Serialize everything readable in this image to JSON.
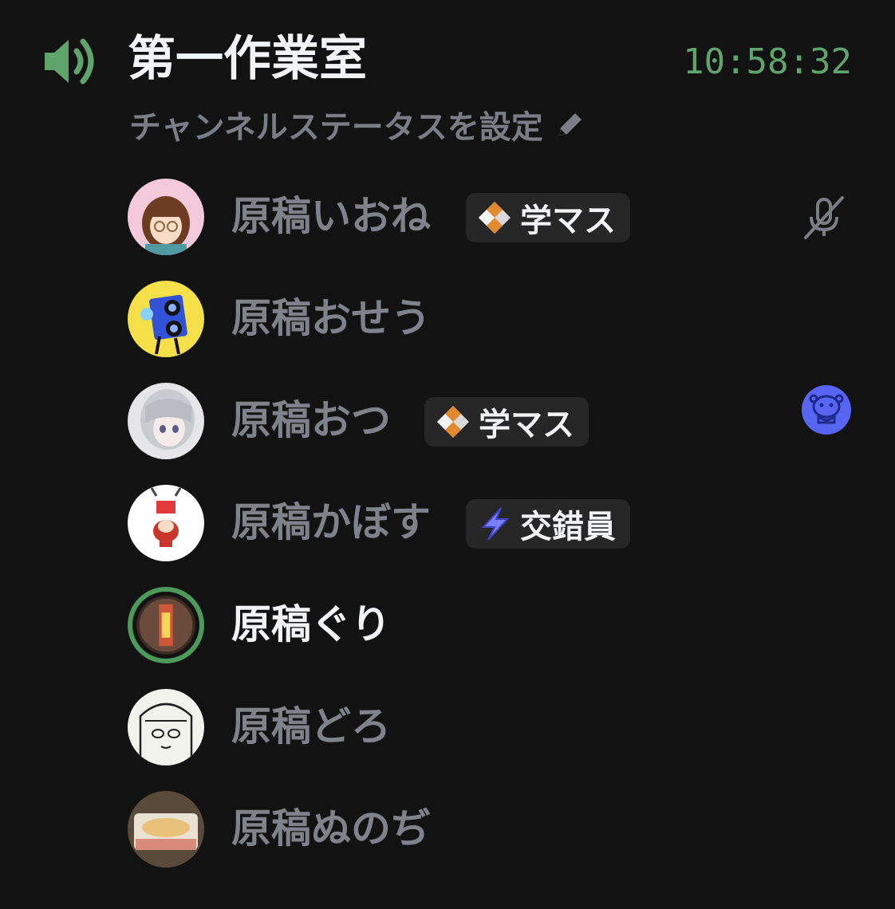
{
  "channel": {
    "name": "第一作業室",
    "timer": "10:58:32",
    "status_prompt": "チャンネルステータスを設定",
    "icon": "speaker-icon",
    "accent_color": "#5fa46a"
  },
  "members": [
    {
      "name": "原稿いおね",
      "tag": {
        "label": "学マス",
        "icon": "diamond-icon"
      },
      "muted": true,
      "speaking": false
    },
    {
      "name": "原稿おせう",
      "tag": null,
      "muted": false,
      "speaking": false
    },
    {
      "name": "原稿おつ",
      "tag": {
        "label": "学マス",
        "icon": "diamond-icon"
      },
      "activity": "activity-icon",
      "speaking": false
    },
    {
      "name": "原稿かぼす",
      "tag": {
        "label": "交錯員",
        "icon": "lightning-icon"
      },
      "muted": false,
      "speaking": false
    },
    {
      "name": "原稿ぐり",
      "tag": null,
      "muted": false,
      "speaking": true
    },
    {
      "name": "原稿どろ",
      "tag": null,
      "muted": false,
      "speaking": false
    },
    {
      "name": "原稿ぬのぢ",
      "tag": null,
      "muted": false,
      "speaking": false
    }
  ]
}
